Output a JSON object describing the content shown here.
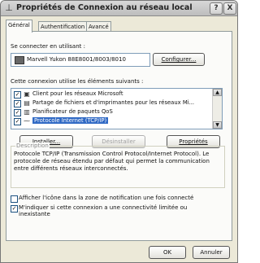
{
  "window": {
    "title": "Propriétés de Connexion au réseau local",
    "help_label": "?",
    "close_label": "X",
    "icon": "network-connection-icon"
  },
  "tabs": [
    {
      "label": "Général",
      "active": true
    },
    {
      "label": "Authentification",
      "active": false
    },
    {
      "label": "Avancé",
      "active": false
    }
  ],
  "general": {
    "connect_label": "Se connecter en utilisant :",
    "device_name": "Marvell Yukon 88E8001/8003/8010",
    "configure_label": "Configurer...",
    "components_label": "Cette connexion utilise les éléments suivants :",
    "items": [
      {
        "label": "Client pour les réseaux Microsoft",
        "checked": true,
        "selected": false,
        "icon": "client-network-icon"
      },
      {
        "label": "Partage de fichiers et d'imprimantes pour les réseaux Mi...",
        "checked": true,
        "selected": false,
        "icon": "file-printer-share-icon"
      },
      {
        "label": "Planificateur de paquets QoS",
        "checked": true,
        "selected": false,
        "icon": "qos-scheduler-icon"
      },
      {
        "label": "Protocole Internet (TCP/IP)",
        "checked": true,
        "selected": true,
        "icon": "protocol-icon"
      }
    ],
    "install_label": "Installer...",
    "uninstall_label": "Désinstaller",
    "properties_label": "Propriétés",
    "description_title": "Description",
    "description_text": "Protocole TCP/IP (Transmission Control Protocol/Internet Protocol). Le protocole de réseau étendu par défaut qui permet la communication entre différents réseaux interconnectés.",
    "show_icon_label": "Afficher l'icône dans la zone de notification une fois connecté",
    "show_icon_checked": false,
    "notify_label_line1": "M'indiquer si cette connexion a une connectivité limitée ou",
    "notify_label_line2": "inexistante",
    "notify_checked": true
  },
  "footer": {
    "ok_label": "OK",
    "cancel_label": "Annuler"
  }
}
